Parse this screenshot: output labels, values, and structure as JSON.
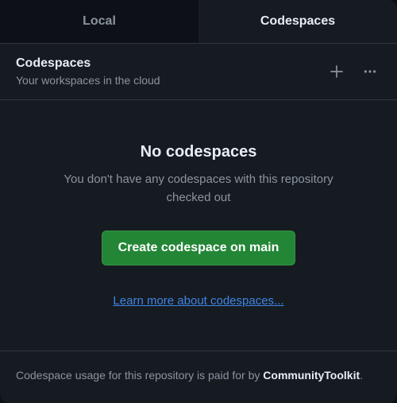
{
  "tabs": {
    "local": "Local",
    "codespaces": "Codespaces"
  },
  "header": {
    "title": "Codespaces",
    "subtitle": "Your workspaces in the cloud"
  },
  "empty": {
    "title": "No codespaces",
    "text": "You don't have any codespaces with this repository checked out",
    "button": "Create codespace on main",
    "link": "Learn more about codespaces..."
  },
  "footer": {
    "prefix": "Codespace usage for this repository is paid for by ",
    "org": "CommunityToolkit",
    "suffix": "."
  }
}
